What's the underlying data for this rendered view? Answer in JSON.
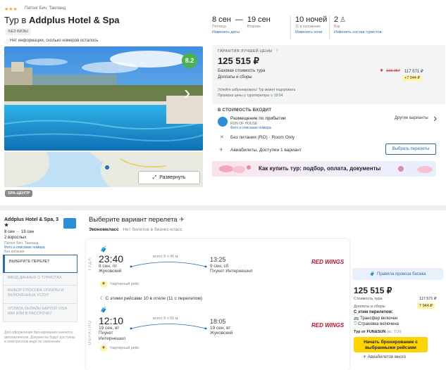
{
  "hotel": {
    "stars": "★★★",
    "location": "Патонг Бич, Таиланд",
    "title_prefix": "Тур в",
    "title_name": "Addplus Hotel & Spa",
    "visa": "БЕЗ ВИЗЫ",
    "rooms_note": "Нет информации, сколько номеров осталось",
    "rating": "8.2",
    "expand_label": "Развернуть",
    "spa_tag": "SPA-ЦЕНТР"
  },
  "trip": {
    "date_from": "8 сен",
    "date_to": "19 сен",
    "day_from": "Пятница",
    "day_to": "Вторник",
    "change_dates": "Изменить даты",
    "nights": "10 ночей",
    "nights_sub": "11 в паломнике",
    "change_nights": "Изменить ночи",
    "adults": "2",
    "adults_sub": "Взр",
    "change_tourists": "Изменить состав туристов"
  },
  "price": {
    "guarantee": "ГАРАНТИЯ ЛУЧШЕЙ ЦЕНЫ",
    "guarantee_q": "?",
    "main": "125 515 ₽",
    "base_label": "Базовая стоимость тура",
    "fees_label": "Доплаты и сборы",
    "old_price": "138 057",
    "alt_price": "117 571 ₽",
    "extra": "+7 944 ₽",
    "note_1": "Успейте забронировать! Тур может подорожать",
    "note_2": "Проверка цены у туроператора",
    "note_time": "19:04"
  },
  "included": {
    "heading": "В СТОИМОСТЬ ВХОДИТ",
    "stay_label": "Размещение по прибытии",
    "room_type": "RUN OF HOUSE",
    "room_link": "Фото и описание номера",
    "other_variants": "Другие варианты",
    "meal": "Без питания (RO) · Room Only",
    "flights": "Авиабилеты, Доступен 1 вариант",
    "choose_flights": "Выбрать перелеты"
  },
  "banner": {
    "text": "Как купить тур: подбор, оплата, документы"
  },
  "sidebar": {
    "hotel_name": "Addplus Hotel & Spa, 3 ★",
    "dates": "8 сен",
    "dates_to": "19 сен",
    "adults": "2 взрослых",
    "location": "Патонг Бич, Таиланд",
    "room_link": "Фото и описание номера",
    "meal": "Без питания",
    "items": [
      {
        "label": "ВЫБЕРИТЕ ПЕРЕЛЕТ"
      },
      {
        "label": "ВВОД ДАННЫХ О ТУРИСТАХ"
      },
      {
        "label": "ВЫБОР СПОСОБА ОПЛАТЫ И ВКЛЮЧЕННЫХ УСЛУГ"
      },
      {
        "label": "ОПЛАТА ОНЛАЙН КАРТОЙ VISA · MIR ИЛИ В РАССРОЧКУ"
      }
    ],
    "footnote": "Для оформления бронирования начнется автоматически. Документы будут доступны в электронном виде по окончании"
  },
  "flights": {
    "heading": "Выберите вариант перелета",
    "class_label": "Экономкласс",
    "class_note": "· Нет билетов в бизнес-класс",
    "there_label": "ТУДА",
    "back_label": "ОБРАТНО",
    "out": {
      "dep_time": "23:40",
      "dep_date": "8 сен, пт",
      "dep_airport": "Жуковский",
      "duration": "всего 9 ч 45 м",
      "arr_time": "13:25",
      "arr_date": "9 сен, сб",
      "arr_airport": "Пхукет Интернешнл",
      "charter": "Чартерный рейс"
    },
    "middle_note": "С этими рейсами 10 в отеле (11 с перелетом)",
    "ret": {
      "dep_time": "12:10",
      "dep_date": "19 сен, вт",
      "dep_airport": "Пхукет Интернешнл",
      "duration": "всего 9 ч 55 м",
      "arr_time": "18:05",
      "arr_date": "19 сен, вт",
      "arr_airport": "Жуковский",
      "charter": "Чартерный рейс"
    },
    "airline": "RED WINGS"
  },
  "booking": {
    "baggage_rules": "Правила провоза багажа",
    "price": "125 515 ₽",
    "tour_cost": "Стоимость тура",
    "tour_cost_val": "117 571 ₽",
    "fees": "Доплаты и сборы",
    "fees_val": "7 944 ₽",
    "with_flight": "С этим перелетом:",
    "transfer": "Трансфер включен",
    "insurance": "Страховка включена",
    "operator": "Тур от FUN&SUN",
    "operator_note": "(кс. TUI)",
    "book_btn": "Начать бронирование с выбранными рейсами",
    "tickets_many": "Авиабилетов много"
  },
  "colors": {
    "brand": "#2b6cb0",
    "accent_yellow": "#ffd400",
    "rating_green": "#4caf50",
    "airline_red": "#c8102e"
  }
}
